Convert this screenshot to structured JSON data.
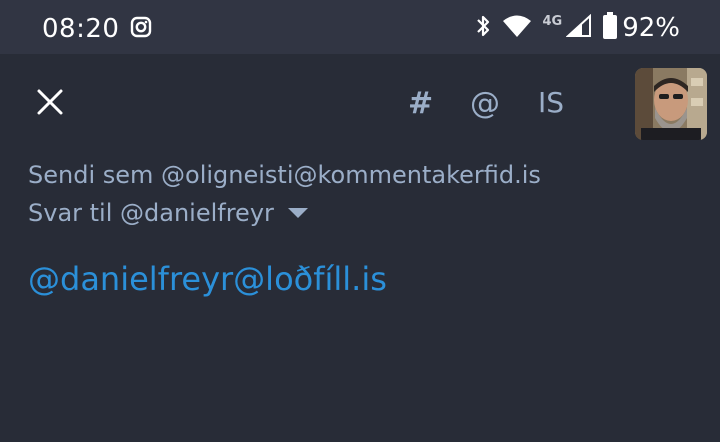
{
  "status_bar": {
    "time": "08:20",
    "network": "4G",
    "battery": "92%",
    "icons": [
      "instagram-icon",
      "bluetooth-icon",
      "wifi-icon",
      "signal-icon",
      "battery-icon"
    ]
  },
  "toolbar": {
    "hashtag_label": "#",
    "mention_label": "@",
    "language_label": "IS"
  },
  "compose": {
    "sender_line": "Sendi sem @oligneisti@kommentakerfid.is",
    "reply_line": "Svar til @danielfreyr",
    "text": "@danielfreyr@loðfíll.is"
  },
  "colors": {
    "background": "#282c37",
    "status_bar": "#313543",
    "muted_text": "#9baec8",
    "link": "#2b90d9"
  }
}
